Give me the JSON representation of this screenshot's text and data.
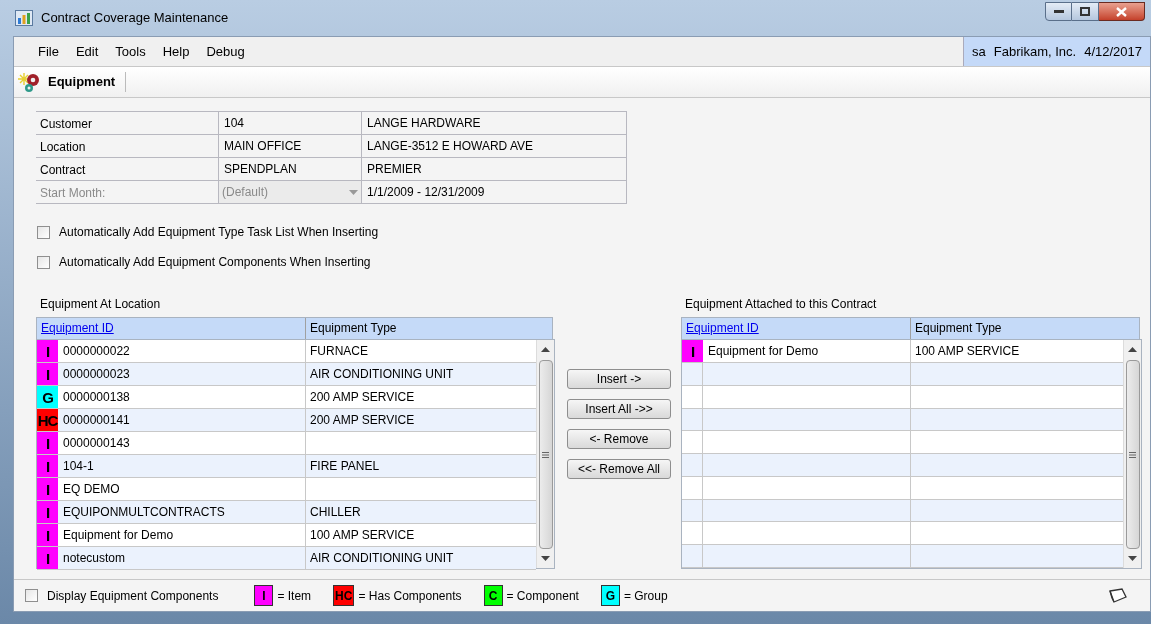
{
  "window": {
    "title": "Contract Coverage Maintenance"
  },
  "menu": [
    "File",
    "Edit",
    "Tools",
    "Help",
    "Debug"
  ],
  "user_info": [
    "sa",
    "Fabrikam, Inc.",
    "4/12/2017"
  ],
  "toolbar": {
    "label": "Equipment"
  },
  "header_fields": [
    {
      "label": "Customer",
      "kind": "text",
      "disabled": false,
      "value": "104",
      "description": "LANGE HARDWARE"
    },
    {
      "label": "Location",
      "kind": "text",
      "disabled": false,
      "value": "MAIN OFFICE",
      "description": "LANGE-3512 E HOWARD AVE"
    },
    {
      "label": "Contract",
      "kind": "text",
      "disabled": false,
      "value": "SPENDPLAN",
      "description": "PREMIER"
    },
    {
      "label": "Start Month:",
      "kind": "dropdown",
      "disabled": true,
      "value": "(Default)",
      "description": "1/1/2009 - 12/31/2009"
    }
  ],
  "options": [
    {
      "label": "Automatically Add Equipment Type Task List When Inserting",
      "checked": false
    },
    {
      "label": "Automatically Add Equipment Components When Inserting",
      "checked": false
    }
  ],
  "available": {
    "title": "Equipment At Location",
    "columns": [
      "Equipment ID",
      "Equipment Type"
    ],
    "rows": [
      {
        "badge": "I",
        "color": "#ff00ff",
        "id": "0000000022",
        "type": "FURNACE"
      },
      {
        "badge": "I",
        "color": "#ff00ff",
        "id": "0000000023",
        "type": "AIR CONDITIONING UNIT"
      },
      {
        "badge": "G",
        "color": "#00ffff",
        "id": "0000000138",
        "type": "200 AMP SERVICE"
      },
      {
        "badge": "HC",
        "color": "#ff0000",
        "id": "0000000141",
        "type": "200 AMP SERVICE"
      },
      {
        "badge": "I",
        "color": "#ff00ff",
        "id": "0000000143"
      },
      {
        "badge": "I",
        "color": "#ff00ff",
        "id": "104-1",
        "type": "FIRE PANEL"
      },
      {
        "badge": "I",
        "color": "#ff00ff",
        "id": "EQ DEMO"
      },
      {
        "badge": "I",
        "color": "#ff00ff",
        "id": "EQUIPONMULTCONTRACTS",
        "type": "CHILLER"
      },
      {
        "badge": "I",
        "color": "#ff00ff",
        "id": "Equipment for Demo",
        "type": "100 AMP SERVICE"
      },
      {
        "badge": "I",
        "color": "#ff00ff",
        "id": "notecustom",
        "type": "AIR CONDITIONING UNIT"
      }
    ]
  },
  "buttons": [
    "Insert ->",
    "Insert All ->>",
    "<- Remove",
    "<<- Remove All"
  ],
  "attached": {
    "title": "Equipment Attached to this Contract",
    "columns": [
      "Equipment ID",
      "Equipment Type"
    ],
    "rows": [
      {
        "badge": "I",
        "color": "#ff00ff",
        "id": "Equipment for Demo",
        "type": "100 AMP SERVICE"
      }
    ]
  },
  "footer": {
    "display_components": {
      "label": "Display Equipment Components",
      "checked": false
    },
    "legend": [
      {
        "badge": "I",
        "color": "#ff00ff",
        "label": "= Item"
      },
      {
        "badge": "HC",
        "color": "#ff0000",
        "label": "= Has Components"
      },
      {
        "badge": "C",
        "color": "#00ff00",
        "label": "= Component"
      },
      {
        "badge": "G",
        "color": "#00ffff",
        "label": "= Group"
      }
    ]
  }
}
